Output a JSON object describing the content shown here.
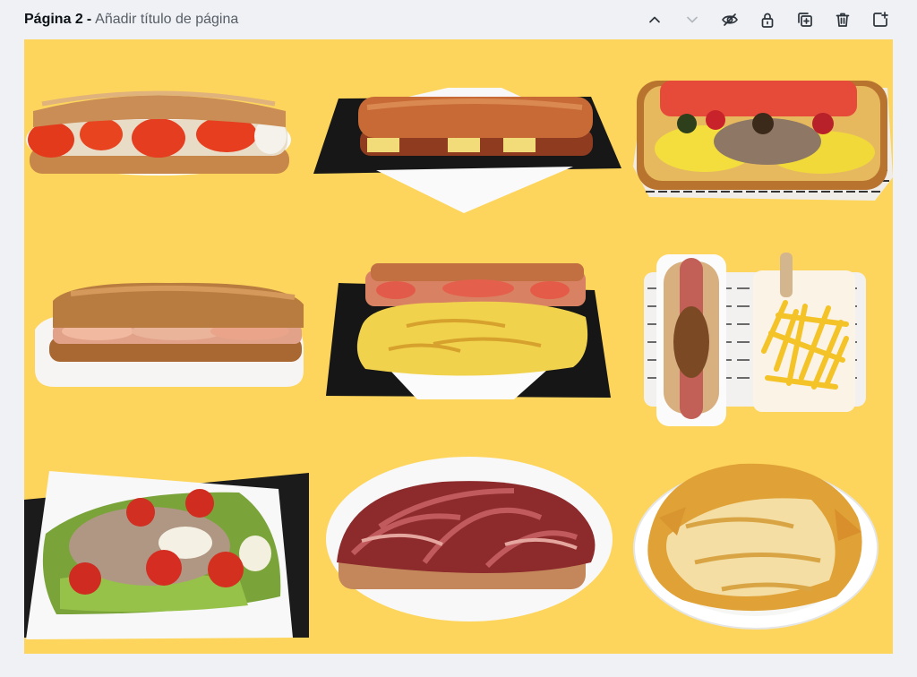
{
  "page": {
    "number_label": "Página 2",
    "separator": "-",
    "title_placeholder": "Añadir título de página"
  },
  "toolbar": {
    "buttons": [
      {
        "name": "move-up",
        "icon": "chevron-up-icon",
        "enabled": true
      },
      {
        "name": "move-down",
        "icon": "chevron-down-icon",
        "enabled": false
      },
      {
        "name": "hide-page",
        "icon": "eye-slash-icon",
        "enabled": true
      },
      {
        "name": "lock-page",
        "icon": "lock-icon",
        "enabled": true
      },
      {
        "name": "duplicate-page",
        "icon": "duplicate-icon",
        "enabled": true
      },
      {
        "name": "delete-page",
        "icon": "trash-icon",
        "enabled": true
      },
      {
        "name": "add-page",
        "icon": "add-page-icon",
        "enabled": true
      }
    ]
  },
  "canvas": {
    "background": "#fdd55c",
    "images": [
      {
        "name": "tomato-mozzarella-baguette"
      },
      {
        "name": "breaded-baguette-on-slate"
      },
      {
        "name": "tuna-egg-open-baguette"
      },
      {
        "name": "ham-baguette"
      },
      {
        "name": "tomato-bread-and-omelette"
      },
      {
        "name": "hot-dog-and-fries"
      },
      {
        "name": "tuna-salad-toast"
      },
      {
        "name": "jamon-serrano-toast"
      },
      {
        "name": "cheese-nachos-plate"
      }
    ]
  }
}
